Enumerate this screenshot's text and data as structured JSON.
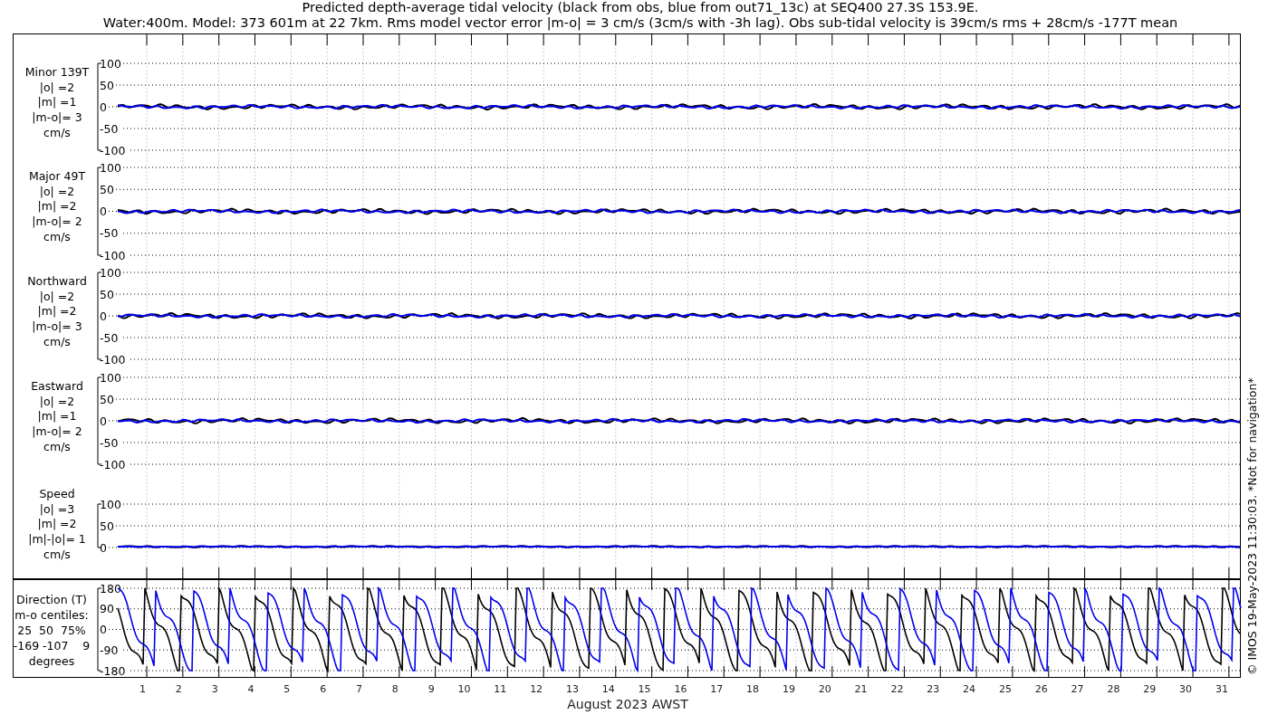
{
  "title_lines": [
    "Predicted depth-average tidal velocity (black from obs, blue from out71_13c) at SEQ400 27.3S 153.9E.",
    "Water:400m. Model: 373 601m at 22 7km. Rms model vector error |m-o| = 3 cm/s (3cm/s with -3h lag). Obs sub-tidal velocity is 39cm/s rms + 28cm/s -177T mean"
  ],
  "panels": [
    {
      "kind": "velocity",
      "label_lines": [
        "Minor 139T",
        "|o| =2",
        "|m| =1",
        "|m-o|= 3",
        "cm/s"
      ],
      "yticks": [
        "100",
        "50",
        "0",
        "-50",
        "-100"
      ]
    },
    {
      "kind": "velocity",
      "label_lines": [
        "Major 49T",
        "|o| =2",
        "|m| =2",
        "|m-o|= 2",
        "cm/s"
      ],
      "yticks": [
        "100",
        "50",
        "0",
        "-50",
        "-100"
      ]
    },
    {
      "kind": "velocity",
      "label_lines": [
        "Northward",
        "|o| =2",
        "|m| =2",
        "|m-o|= 3",
        "cm/s"
      ],
      "yticks": [
        "100",
        "50",
        "0",
        "-50",
        "-100"
      ]
    },
    {
      "kind": "velocity",
      "label_lines": [
        "Eastward",
        "|o| =2",
        "|m| =1",
        "|m-o|= 2",
        "cm/s"
      ],
      "yticks": [
        "100",
        "50",
        "0",
        "-50",
        "-100"
      ]
    },
    {
      "kind": "speed",
      "label_lines": [
        "Speed",
        "|o| =3",
        "|m| =2",
        "|m|-|o|= 1",
        "cm/s"
      ],
      "yticks": [
        "100",
        "50",
        "0"
      ]
    }
  ],
  "direction_panel": {
    "label_lines": [
      "Direction (T)",
      "m-o centiles:",
      "25  50  75%",
      "-169 -107    9",
      "degrees"
    ],
    "yticks": [
      "180",
      "90",
      "0",
      "-90",
      "-180"
    ]
  },
  "x_axis": {
    "day_labels": [
      "1",
      "2",
      "3",
      "4",
      "5",
      "6",
      "7",
      "8",
      "9",
      "10",
      "11",
      "12",
      "13",
      "14",
      "15",
      "16",
      "17",
      "18",
      "19",
      "20",
      "21",
      "22",
      "23",
      "24",
      "25",
      "26",
      "27",
      "28",
      "29",
      "30",
      "31"
    ],
    "title": "August 2023 AWST"
  },
  "side_note": "© IMOS 19-May-2023 11:30:03.  *Not for navigation*"
}
